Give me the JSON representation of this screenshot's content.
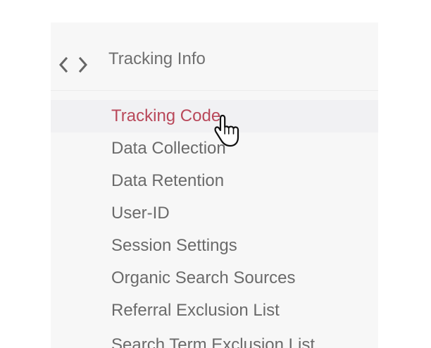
{
  "section": {
    "title": "Tracking Info",
    "icon": "code-icon"
  },
  "menu": {
    "items": [
      {
        "label": "Tracking Code",
        "active": true
      },
      {
        "label": "Data Collection",
        "active": false
      },
      {
        "label": "Data Retention",
        "active": false
      },
      {
        "label": "User-ID",
        "active": false
      },
      {
        "label": "Session Settings",
        "active": false
      },
      {
        "label": "Organic Search Sources",
        "active": false
      },
      {
        "label": "Referral Exclusion List",
        "active": false
      },
      {
        "label": "Search Term Exclusion List",
        "active": false
      }
    ]
  },
  "colors": {
    "active_text": "#b9485a",
    "text": "#6a6a6a",
    "panel_background": "#f7f7f7"
  },
  "cursor": {
    "icon": "hand-pointer-icon"
  }
}
